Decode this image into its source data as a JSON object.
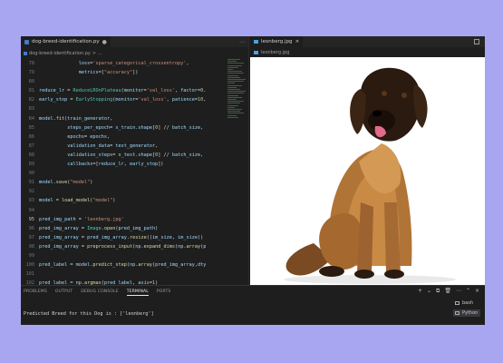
{
  "editor": {
    "tab_label": "dog-breed-identification.py",
    "tab_dot": "●",
    "tab_actions": [
      "⋯"
    ],
    "breadcrumb_file": "dog-breed-identification.py",
    "breadcrumb_more": "> ..."
  },
  "code_lines": [
    {
      "ln": "78",
      "text": "              loss='sparse_categorical_crossentropy',"
    },
    {
      "ln": "79",
      "text": "              metrics=[\"accuracy\"])"
    },
    {
      "ln": "80",
      "text": ""
    },
    {
      "ln": "81",
      "text": "reduce_lr = ReduceLROnPlateau(monitor='val_loss', factor=0."
    },
    {
      "ln": "82",
      "text": "early_stop = EarlyStopping(monitor='val_loss', patience=10,"
    },
    {
      "ln": "83",
      "text": ""
    },
    {
      "ln": "84",
      "text": "model.fit(train_generator,"
    },
    {
      "ln": "85",
      "text": "          steps_per_epoch= x_train.shape[0] // batch_size,"
    },
    {
      "ln": "86",
      "text": "          epochs= epochs,"
    },
    {
      "ln": "87",
      "text": "          validation_data= test_generator,"
    },
    {
      "ln": "88",
      "text": "          validation_steps= x_test.shape[0] // batch_size,"
    },
    {
      "ln": "89",
      "text": "          callbacks=[reduce_lr, early_stop])"
    },
    {
      "ln": "90",
      "text": ""
    },
    {
      "ln": "91",
      "text": "model.save(\"model\")"
    },
    {
      "ln": "92",
      "text": ""
    },
    {
      "ln": "93",
      "text": "model = load_model(\"model\")"
    },
    {
      "ln": "94",
      "text": ""
    },
    {
      "ln": "95",
      "text": "pred_img_path = 'leonberg.jpg'"
    },
    {
      "ln": "96",
      "text": "pred_img_array = Image.open(pred_img_path)"
    },
    {
      "ln": "97",
      "text": "pred_img_array = pred_img_array.resize((im_size, im_size))"
    },
    {
      "ln": "98",
      "text": "pred_img_array = preprocess_input(np.expand_dims(np.array(p"
    },
    {
      "ln": "99",
      "text": ""
    },
    {
      "ln": "100",
      "text": "pred_label = model.predict_step(np.array(pred_img_array,dty"
    },
    {
      "ln": "101",
      "text": ""
    },
    {
      "ln": "102",
      "text": "pred_label = np.argmax(pred_label, axis=1)"
    }
  ],
  "active_line": "95",
  "image_view": {
    "tab_label": "leonberg.jpg",
    "close_glyph": "×",
    "breadcrumb": "leonberg.jpg",
    "image_subject": "Leonberger puppy sitting"
  },
  "panel": {
    "tabs": [
      "PROBLEMS",
      "OUTPUT",
      "DEBUG CONSOLE",
      "TERMINAL",
      "PORTS"
    ],
    "active_tab": "TERMINAL",
    "actions": [
      "+",
      "⌄",
      "⧉",
      "🗑",
      "⋯",
      "⌃",
      "×"
    ],
    "output": "Predicted Breed for this Dog is : ['leonberg']",
    "terminals": [
      {
        "label": "bash",
        "selected": false
      },
      {
        "label": "Python",
        "selected": true
      }
    ]
  },
  "colors": {
    "background": "#a8a6f0",
    "editor_bg": "#1e1e1e",
    "keyword": "#569cd6",
    "string": "#ce9178",
    "function": "#dcdcaa",
    "class": "#4ec9b0",
    "variable": "#9cdcfe"
  }
}
